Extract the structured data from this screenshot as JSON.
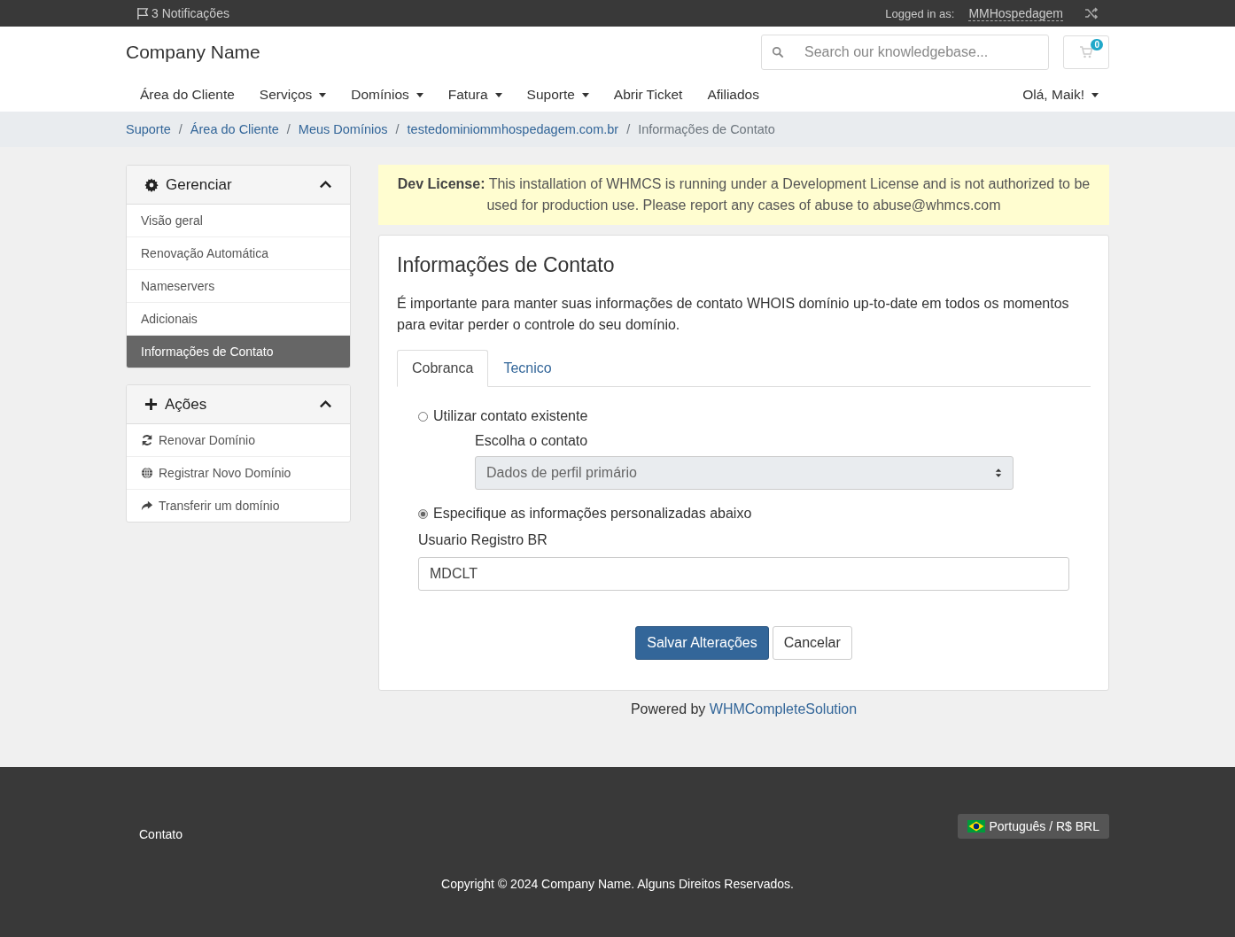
{
  "topbar": {
    "notifications": "3 Notificações",
    "logged_in_label": "Logged in as:",
    "username": "MMHospedagem"
  },
  "header": {
    "brand": "Company Name",
    "search": {
      "placeholder": "Search our knowledgebase..."
    },
    "cart_count": "0"
  },
  "nav": {
    "items": [
      {
        "label": "Área do Cliente",
        "dropdown": false
      },
      {
        "label": "Serviços",
        "dropdown": true
      },
      {
        "label": "Domínios",
        "dropdown": true
      },
      {
        "label": "Fatura",
        "dropdown": true
      },
      {
        "label": "Suporte",
        "dropdown": true
      },
      {
        "label": "Abrir Ticket",
        "dropdown": false
      },
      {
        "label": "Afiliados",
        "dropdown": false
      }
    ],
    "user_menu": {
      "label": "Olá, Maik!",
      "dropdown": true
    }
  },
  "breadcrumb": [
    {
      "label": "Suporte",
      "link": true
    },
    {
      "separator": "/",
      "label": "Área do Cliente",
      "link": true
    },
    {
      "separator": "/",
      "label": "Meus Domínios",
      "link": true
    },
    {
      "separator": "/",
      "label": "testedominiommhospedagem.com.br",
      "link": true
    },
    {
      "separator": "/",
      "label": "Informações de Contato",
      "link": false
    }
  ],
  "sidebar": [
    {
      "title": "Gerenciar",
      "expanded": true,
      "items": [
        {
          "label": "Visão geral",
          "selected": false
        },
        {
          "label": "Renovação Automática",
          "selected": false
        },
        {
          "label": "Nameservers",
          "selected": false
        },
        {
          "label": "Adicionais",
          "selected": false
        },
        {
          "label": "Informações de Contato",
          "selected": true
        }
      ]
    },
    {
      "title": "Ações",
      "expanded": true,
      "items": [
        {
          "label": "Renovar Domínio",
          "selected": false
        },
        {
          "label": "Registrar Novo Domínio",
          "selected": false
        },
        {
          "label": "Transferir um domínio",
          "selected": false
        }
      ]
    }
  ],
  "notice": "**Dev License:** This installation of WHMCS is running under a Development License and is not authorized to be used for production use. Please report any cases of abuse to abuse@whmcs.com",
  "card": {
    "title": "Informações de Contato",
    "intro": "É importante para manter suas informações de contato WHOIS domínio up-to-date em todos os momentos para evitar perder o controle do seu domínio.",
    "tabs": [
      {
        "label": "Cobranca",
        "selected": true
      },
      {
        "label": "Tecnico",
        "selected": false
      }
    ],
    "options": [
      {
        "label": "Utilizar contato existente",
        "selected": false,
        "field": {
          "kind": "select",
          "label": "Escolha o contato",
          "value": "Dados de perfil primário",
          "disabled": true
        }
      },
      {
        "label": "Especifique as informações personalizadas abaixo",
        "selected": true,
        "field": {
          "kind": "input",
          "label": "Usuario Registro BR",
          "value": "MDCLT",
          "disabled": false
        }
      }
    ],
    "buttons": [
      {
        "label": "Salvar Alterações",
        "kind": "primary"
      },
      {
        "label": "Cancelar",
        "kind": "default"
      }
    ]
  },
  "powered_by": {
    "text": "Powered by",
    "link": "WHMCompleteSolution"
  },
  "footer": {
    "link": "Contato",
    "language": "Português / R$ BRL",
    "copyright": "Copyright © 2024 Company Name. Alguns Direitos Reservados."
  }
}
